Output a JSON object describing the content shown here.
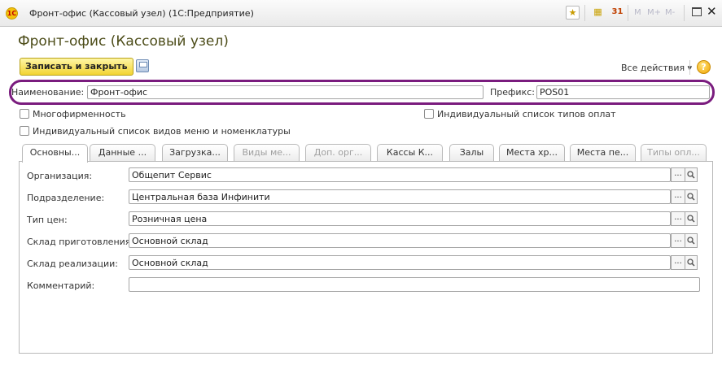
{
  "window": {
    "logo_text": "1С",
    "title": "Фронт-офис (Кассовый узел)  (1С:Предприятие)",
    "toolbar_m": "M",
    "toolbar_mplus": "M+",
    "toolbar_mminus": "M-",
    "calendar_text": "31"
  },
  "form": {
    "title": "Фронт-офис (Кассовый узел)",
    "save_close_label": "Записать и закрыть",
    "all_actions_label": "Все действия ▾",
    "help_label": "?"
  },
  "name_field": {
    "label": "Наименование:",
    "value": "Фронт-офис"
  },
  "prefix_field": {
    "label": "Префикс:",
    "value": "POS01"
  },
  "checkboxes": {
    "multi_company": "Многофирменность",
    "payment_types": "Индивидуальный список типов оплат",
    "menu_list": "Индивидуальный список видов меню и номенклатуры"
  },
  "tabs": [
    {
      "label": "Основны..."
    },
    {
      "label": "Данные ..."
    },
    {
      "label": "Загрузка..."
    },
    {
      "label": "Виды ме..."
    },
    {
      "label": "Доп. орг..."
    },
    {
      "label": "Кассы К..."
    },
    {
      "label": "Залы"
    },
    {
      "label": "Места хр..."
    },
    {
      "label": "Места пе..."
    },
    {
      "label": "Типы опл..."
    }
  ],
  "fields": [
    {
      "label": "Организация:",
      "value": "Общепит Сервис"
    },
    {
      "label": "Подразделение:",
      "value": "Центральная база Инфинити"
    },
    {
      "label": "Тип цен:",
      "value": "Розничная цена"
    },
    {
      "label": "Склад приготовления:",
      "value": "Основной склад"
    },
    {
      "label": "Склад реализации:",
      "value": "Основной склад"
    },
    {
      "label": "Комментарий:",
      "value": ""
    }
  ],
  "select_btn_text": "...",
  "colors": {
    "highlight": "#7a1c7e",
    "primary_button": "#f2d433"
  }
}
